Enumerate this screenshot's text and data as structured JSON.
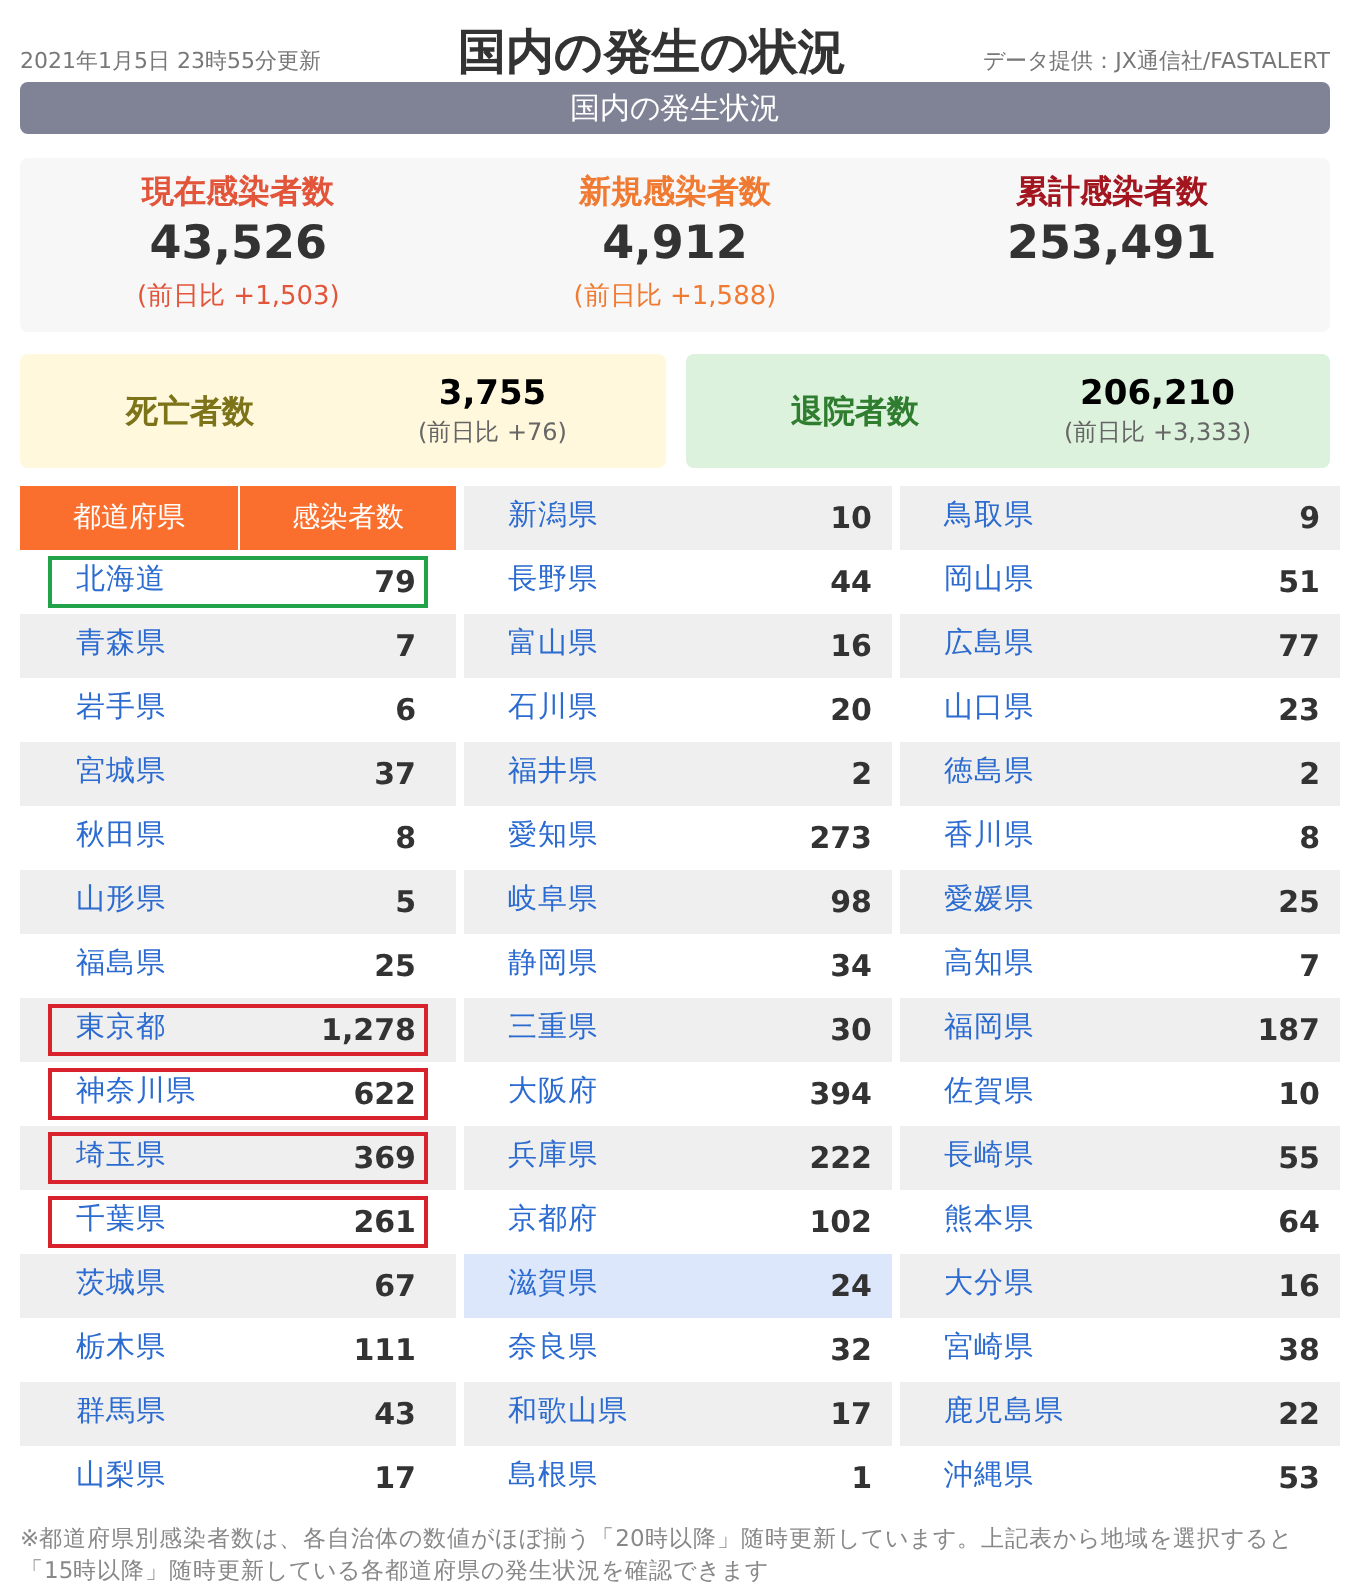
{
  "header": {
    "updated": "2021年1月5日 23時55分更新",
    "title": "国内の発生の状況",
    "source": "データ提供：JX通信社/FASTALERT"
  },
  "banner": "国内の発生状況",
  "stats": [
    {
      "label": "現在感染者数",
      "value": "43,526",
      "change": "(前日比 +1,503)",
      "color": "#e2553a"
    },
    {
      "label": "新規感染者数",
      "value": "4,912",
      "change": "(前日比 +1,588)",
      "color": "#f07a32"
    },
    {
      "label": "累計感染者数",
      "value": "253,491",
      "color": "#a3161f"
    }
  ],
  "outcomes": [
    {
      "label": "死亡者数",
      "value": "3,755",
      "change": "(前日比 +76)",
      "color": "#7d7319"
    },
    {
      "label": "退院者数",
      "value": "206,210",
      "change": "(前日比 +3,333)",
      "color": "#2f7d2f"
    }
  ],
  "table": {
    "columns": [
      "都道府県",
      "感染者数"
    ],
    "groups": [
      [
        {
          "name": "北海道",
          "count": "79",
          "selected": false,
          "color": "#22a34a"
        },
        {
          "name": "青森県",
          "count": "7",
          "selected": false
        },
        {
          "name": "岩手県",
          "count": "6",
          "selected": false
        },
        {
          "name": "宮城県",
          "count": "37",
          "selected": false
        },
        {
          "name": "秋田県",
          "count": "8",
          "selected": false
        },
        {
          "name": "山形県",
          "count": "5",
          "selected": false
        },
        {
          "name": "福島県",
          "count": "25",
          "selected": false
        },
        {
          "name": "東京都",
          "count": "1,278",
          "selected": false,
          "color": "#d8222c"
        },
        {
          "name": "神奈川県",
          "count": "622",
          "selected": false,
          "color": "#d8222c"
        },
        {
          "name": "埼玉県",
          "count": "369",
          "selected": false,
          "color": "#d8222c"
        },
        {
          "name": "千葉県",
          "count": "261",
          "selected": false,
          "color": "#d8222c"
        },
        {
          "name": "茨城県",
          "count": "67",
          "selected": false
        },
        {
          "name": "栃木県",
          "count": "111",
          "selected": false
        },
        {
          "name": "群馬県",
          "count": "43",
          "selected": false
        },
        {
          "name": "山梨県",
          "count": "17",
          "selected": false
        }
      ],
      [
        {
          "name": "新潟県",
          "count": "10",
          "selected": false
        },
        {
          "name": "長野県",
          "count": "44",
          "selected": false
        },
        {
          "name": "富山県",
          "count": "16",
          "selected": false
        },
        {
          "name": "石川県",
          "count": "20",
          "selected": false
        },
        {
          "name": "福井県",
          "count": "2",
          "selected": false
        },
        {
          "name": "愛知県",
          "count": "273",
          "selected": false
        },
        {
          "name": "岐阜県",
          "count": "98",
          "selected": false
        },
        {
          "name": "静岡県",
          "count": "34",
          "selected": false
        },
        {
          "name": "三重県",
          "count": "30",
          "selected": false
        },
        {
          "name": "大阪府",
          "count": "394",
          "selected": false
        },
        {
          "name": "兵庫県",
          "count": "222",
          "selected": false
        },
        {
          "name": "京都府",
          "count": "102",
          "selected": false
        },
        {
          "name": "滋賀県",
          "count": "24",
          "selected": true
        },
        {
          "name": "奈良県",
          "count": "32",
          "selected": false
        },
        {
          "name": "和歌山県",
          "count": "17",
          "selected": false
        },
        {
          "name": "島根県",
          "count": "1",
          "selected": false
        }
      ],
      [
        {
          "name": "鳥取県",
          "count": "9",
          "selected": false
        },
        {
          "name": "岡山県",
          "count": "51",
          "selected": false
        },
        {
          "name": "広島県",
          "count": "77",
          "selected": false
        },
        {
          "name": "山口県",
          "count": "23",
          "selected": false
        },
        {
          "name": "徳島県",
          "count": "2",
          "selected": false
        },
        {
          "name": "香川県",
          "count": "8",
          "selected": false
        },
        {
          "name": "愛媛県",
          "count": "25",
          "selected": false
        },
        {
          "name": "高知県",
          "count": "7",
          "selected": false
        },
        {
          "name": "福岡県",
          "count": "187",
          "selected": false
        },
        {
          "name": "佐賀県",
          "count": "10",
          "selected": false
        },
        {
          "name": "長崎県",
          "count": "55",
          "selected": false
        },
        {
          "name": "熊本県",
          "count": "64",
          "selected": false
        },
        {
          "name": "大分県",
          "count": "16",
          "selected": false
        },
        {
          "name": "宮崎県",
          "count": "38",
          "selected": false
        },
        {
          "name": "鹿児島県",
          "count": "22",
          "selected": false
        },
        {
          "name": "沖縄県",
          "count": "53",
          "selected": false
        }
      ]
    ]
  },
  "footnote": "※都道府県別感染者数は、各自治体の数値がほぼ揃う「20時以降」随時更新しています。上記表から地域を選択すると「15時以降」随時更新している各都道府県の発生状況を確認できます"
}
